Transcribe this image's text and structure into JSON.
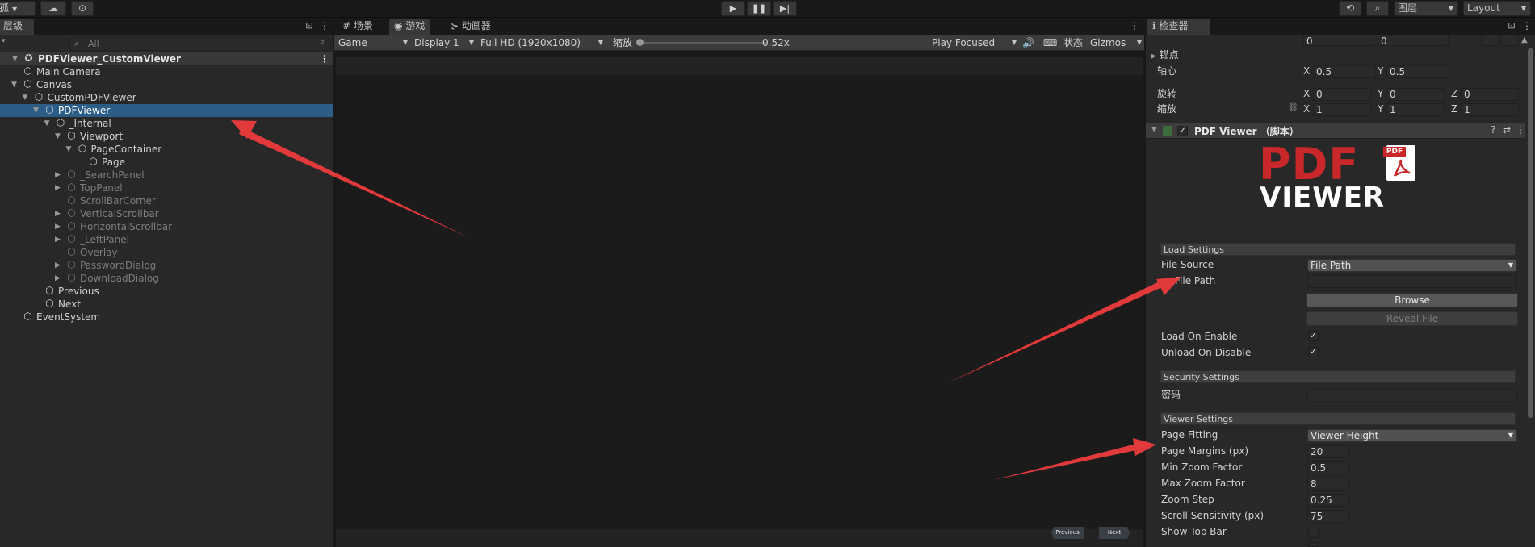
{
  "toolbar": {
    "account_label": "孤",
    "play_icon": "play-icon",
    "pause_icon": "pause-icon",
    "step_icon": "step-icon",
    "layers_label": "图层",
    "layout_label": "Layout"
  },
  "hierarchy": {
    "tab_label": "层级",
    "search_placeholder": "All",
    "scene_name": "PDFViewer_CustomViewer",
    "items": [
      {
        "label": "Main Camera",
        "depth": 1,
        "expand": "",
        "dim": false,
        "selected": false
      },
      {
        "label": "Canvas",
        "depth": 1,
        "expand": "open",
        "dim": false,
        "selected": false
      },
      {
        "label": "CustomPDFViewer",
        "depth": 2,
        "expand": "open",
        "dim": false,
        "selected": false
      },
      {
        "label": "PDFViewer",
        "depth": 3,
        "expand": "open",
        "dim": false,
        "selected": true
      },
      {
        "label": "_Internal",
        "depth": 4,
        "expand": "open",
        "dim": false,
        "selected": false
      },
      {
        "label": "Viewport",
        "depth": 5,
        "expand": "open",
        "dim": false,
        "selected": false
      },
      {
        "label": "PageContainer",
        "depth": 6,
        "expand": "open",
        "dim": false,
        "selected": false
      },
      {
        "label": "Page",
        "depth": 7,
        "expand": "",
        "dim": false,
        "selected": false
      },
      {
        "label": "_SearchPanel",
        "depth": 5,
        "expand": "closed",
        "dim": true,
        "selected": false
      },
      {
        "label": "TopPanel",
        "depth": 5,
        "expand": "closed",
        "dim": true,
        "selected": false
      },
      {
        "label": "ScrollBarCorner",
        "depth": 5,
        "expand": "",
        "dim": true,
        "selected": false
      },
      {
        "label": "VerticalScrollbar",
        "depth": 5,
        "expand": "closed",
        "dim": true,
        "selected": false
      },
      {
        "label": "HorizontalScrollbar",
        "depth": 5,
        "expand": "closed",
        "dim": true,
        "selected": false
      },
      {
        "label": "_LeftPanel",
        "depth": 5,
        "expand": "closed",
        "dim": true,
        "selected": false
      },
      {
        "label": "Overlay",
        "depth": 5,
        "expand": "",
        "dim": true,
        "selected": false
      },
      {
        "label": "PasswordDialog",
        "depth": 5,
        "expand": "closed",
        "dim": true,
        "selected": false
      },
      {
        "label": "DownloadDialog",
        "depth": 5,
        "expand": "closed",
        "dim": true,
        "selected": false
      },
      {
        "label": "Previous",
        "depth": 3,
        "expand": "",
        "dim": false,
        "selected": false
      },
      {
        "label": "Next",
        "depth": 3,
        "expand": "",
        "dim": false,
        "selected": false
      },
      {
        "label": "EventSystem",
        "depth": 1,
        "expand": "",
        "dim": false,
        "selected": false
      }
    ]
  },
  "game": {
    "tabs": {
      "scene": "场景",
      "game": "游戏",
      "animator": "动画器"
    },
    "game_dropdown": "Game",
    "display_dropdown": "Display 1",
    "resolution_dropdown": "Full HD (1920x1080)",
    "scale_label": "缩放",
    "scale_value": "0.52x",
    "play_focused": "Play Focused",
    "stats_label": "状态",
    "gizmos_label": "Gizmos",
    "prev_button": "Previous",
    "next_button": "Next"
  },
  "inspector": {
    "tab_label": "检查器",
    "top_values": [
      "0",
      "0"
    ],
    "anchors_label": "锚点",
    "pivot_label": "轴心",
    "pivot": {
      "x": "0.5",
      "y": "0.5"
    },
    "rotation_label": "旋转",
    "rotation": {
      "x": "0",
      "y": "0",
      "z": "0"
    },
    "scale_label": "缩放",
    "scale": {
      "x": "1",
      "y": "1",
      "z": "1"
    },
    "component_title": "PDF Viewer （脚本）",
    "logo": {
      "pdf": "PDF",
      "viewer": "VIEWER",
      "badge": "PDF"
    },
    "load_settings": {
      "header": "Load Settings",
      "file_source_label": "File Source",
      "file_source_value": "File Path",
      "file_path_label": "File Path",
      "file_path_value": "",
      "browse_button": "Browse",
      "reveal_button": "Reveal File",
      "load_on_enable_label": "Load On Enable",
      "unload_on_disable_label": "Unload On Disable"
    },
    "security_settings": {
      "header": "Security Settings",
      "password_label": "密码",
      "password_value": ""
    },
    "viewer_settings": {
      "header": "Viewer Settings",
      "page_fitting_label": "Page Fitting",
      "page_fitting_value": "Viewer Height",
      "fields": [
        {
          "label": "Page Margins (px)",
          "value": "20"
        },
        {
          "label": "Min Zoom Factor",
          "value": "0.5"
        },
        {
          "label": "Max Zoom Factor",
          "value": "8"
        },
        {
          "label": "Zoom Step",
          "value": "0.25"
        },
        {
          "label": "Scroll Sensitivity (px)",
          "value": "75"
        }
      ],
      "show_top_bar_label": "Show Top Bar"
    }
  },
  "colors": {
    "selection": "#2c5d87",
    "annotation_arrow": "#e23a3a",
    "pdf_red": "#c8282a"
  }
}
